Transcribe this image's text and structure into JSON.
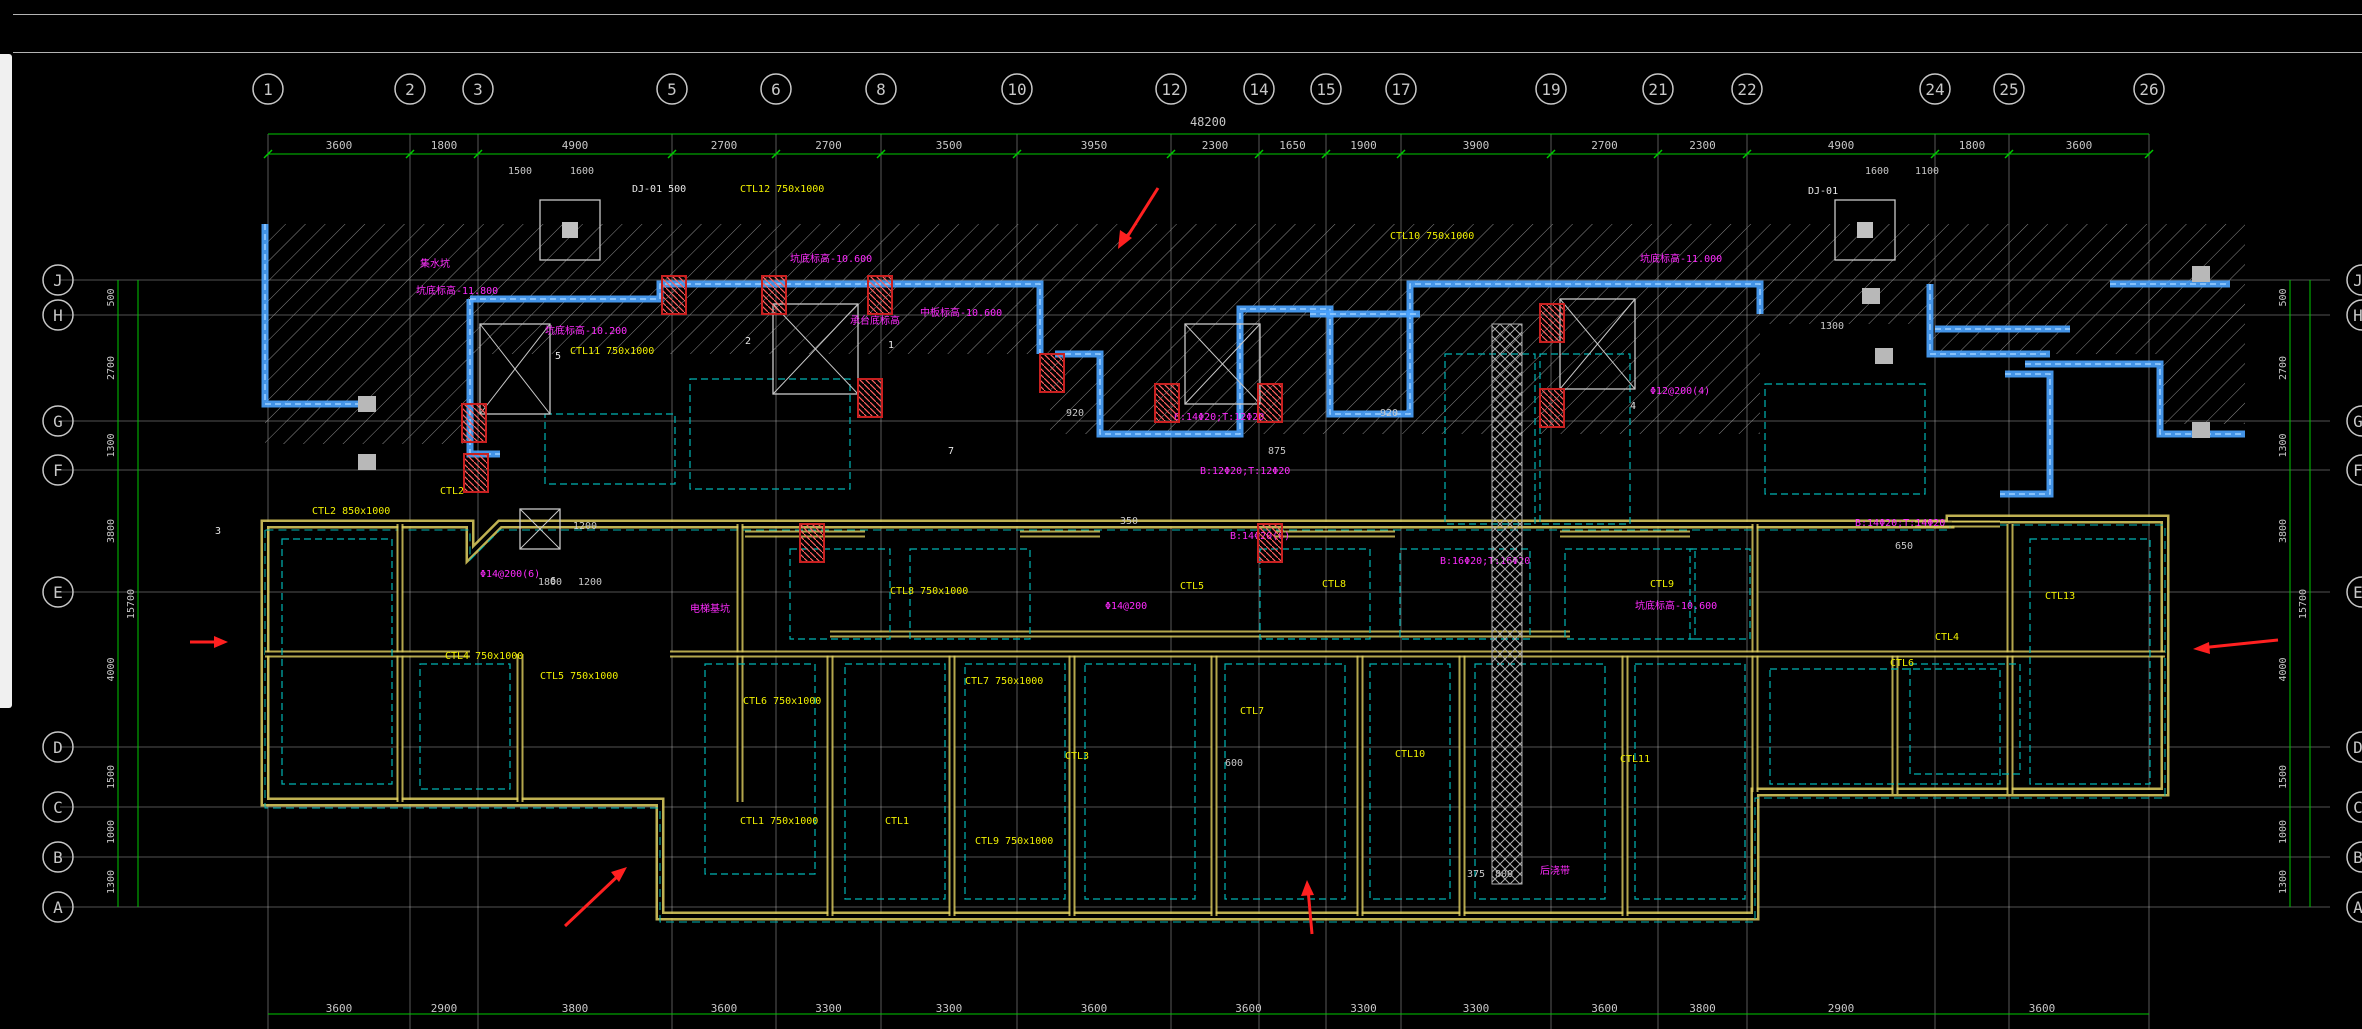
{
  "app": {
    "name": "CAD drawing viewport"
  },
  "colors": {
    "background": "#000000",
    "axis": "#c8c8c8",
    "dim": "#00c800",
    "wall": "#4aa3ff",
    "beam": "#e0d060",
    "dashed": "#00b4b4",
    "magenta": "#ff2bff",
    "yellow_text": "#f0f000",
    "column_red": "#c82020",
    "arrow": "#ff2020"
  },
  "drawing": {
    "top_axes": [
      "1",
      "2",
      "3",
      "5",
      "6",
      "8",
      "10",
      "12",
      "14",
      "15",
      "17",
      "19",
      "21",
      "22",
      "24",
      "25",
      "26"
    ],
    "side_axes": [
      "J",
      "H",
      "G",
      "F",
      "E",
      "D",
      "C",
      "B",
      "A"
    ],
    "overall_dimension": "48200",
    "top_spacings": [
      "3600",
      "1800",
      "4900",
      "2700",
      "2700",
      "3500",
      "3950",
      "2300",
      "1650",
      "1900",
      "3900",
      "2700",
      "2300",
      "4900",
      "1800",
      "3600"
    ],
    "bottom_spacings": [
      "3600",
      "2900",
      "3800",
      "3600",
      "3300",
      "3300",
      "3600",
      "3600",
      "3300",
      "3300",
      "3600",
      "3800",
      "2900",
      "3600"
    ],
    "left_spacings": [
      "500",
      "2700",
      "1300",
      "3800",
      "4000",
      "1500",
      "1000",
      "1300"
    ],
    "right_spacings": [
      "500",
      "2700",
      "1300",
      "3800",
      "4000",
      "1500",
      "1000",
      "1300"
    ],
    "side_total": "15700",
    "sub_dimensions": [
      "1500",
      "1600",
      "1600",
      "1100",
      "1200",
      "1800",
      "1200",
      "375",
      "800",
      "920",
      "920",
      "875",
      "600",
      "650",
      "1300",
      "350"
    ],
    "labels_magenta": [
      "集水坑",
      "坑底标高-10.600",
      "坑底标高-11.000",
      "坑底标高-11.800",
      "坑底标高-10.200",
      "承台底标高",
      "中板标高-10.600",
      "B:14Φ20;T:12Φ20",
      "Φ12@200(4)",
      "Φ14@200(6)",
      "B:12Φ20;T:12Φ20",
      "B:16Φ20;T:16Φ20",
      "B:14Φ20;T:14Φ20",
      "B:14Φ20(6)",
      "Φ14@200",
      "电梯基坑",
      "坑底标高-10.600",
      "后浇带"
    ],
    "labels_yellow": [
      "CTL12 750x1000",
      "CTL11 750x1000",
      "CTL10 750x1000",
      "CTL2 850x1000",
      "CTL2",
      "CTL4 750x1000",
      "CTL5 750x1000",
      "CTL6 750x1000",
      "CTL7 750x1000",
      "CTL8 750x1000",
      "CTL9 750x1000",
      "CTL1 750x1000",
      "CTL1",
      "CTL3",
      "CTL5",
      "CTL7",
      "CTL8",
      "CTL9",
      "CTL10",
      "CTL11",
      "CTL6",
      "CTL4",
      "CTL13"
    ],
    "labels_white": [
      "DJ-01 500",
      "DJ-01",
      "5",
      "2",
      "3",
      "1",
      "4",
      "6",
      "7"
    ]
  }
}
